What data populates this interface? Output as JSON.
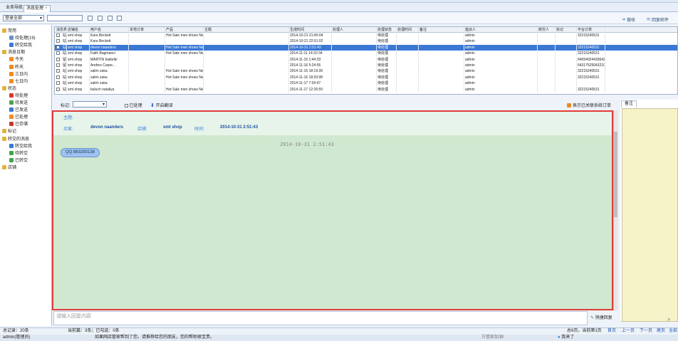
{
  "tabs": {
    "nav": "业务导航",
    "current": "消息处理"
  },
  "toolbar": {
    "account_select": "登录全部",
    "search_value": "",
    "right_buttons": [
      "搜收",
      "回复邮件"
    ]
  },
  "sidebar": {
    "items": [
      {
        "label": "常用",
        "level": 0,
        "icon": "folder-icon"
      },
      {
        "label": "待处理(19)",
        "level": 1,
        "icon": "hand-icon"
      },
      {
        "label": "转交给我",
        "level": 1,
        "icon": "forward-icon"
      },
      {
        "label": "消息日期",
        "level": 0,
        "icon": "folder-icon"
      },
      {
        "label": "今天",
        "level": 1,
        "icon": "calendar-icon"
      },
      {
        "label": "昨天",
        "level": 1,
        "icon": "calendar-icon"
      },
      {
        "label": "三日内",
        "level": 1,
        "icon": "calendar-icon"
      },
      {
        "label": "七日内",
        "level": 1,
        "icon": "calendar-icon"
      },
      {
        "label": "状态",
        "level": 0,
        "icon": "folder-icon"
      },
      {
        "label": "待处理",
        "level": 1,
        "icon": "red-dot-icon"
      },
      {
        "label": "待发送",
        "level": 1,
        "icon": "check-icon"
      },
      {
        "label": "已发送",
        "level": 1,
        "icon": "arrow-icon"
      },
      {
        "label": "已处理",
        "level": 1,
        "icon": "orange-icon"
      },
      {
        "label": "已存储",
        "level": 1,
        "icon": "store-icon"
      },
      {
        "label": "标记",
        "level": 0,
        "icon": "folder-icon"
      },
      {
        "label": "转交的消息",
        "level": 0,
        "icon": "folder-icon"
      },
      {
        "label": "转交给我",
        "level": 1,
        "icon": "forward-icon"
      },
      {
        "label": "待转交",
        "level": 1,
        "icon": "star-icon"
      },
      {
        "label": "已转交",
        "level": 1,
        "icon": "star-icon"
      },
      {
        "label": "店铺",
        "level": 0,
        "icon": "folder-icon"
      }
    ]
  },
  "grid": {
    "columns": [
      "消息类型",
      "店铺名",
      "用户名",
      "本地订单",
      "产品",
      "主题",
      "生成时间",
      "处理人",
      "处理状态",
      "处理时间",
      "备注",
      "指派人",
      "转交人",
      "标记",
      "平台订单"
    ],
    "rows": [
      [
        "站内信",
        "smt shop",
        "Kara Beckett",
        "",
        "Hot Sale men shoes New Style 2014 S...",
        "",
        "2014-10-21 21:45:04",
        "",
        "待处理",
        "",
        "",
        "admin",
        "",
        "",
        "32215240531"
      ],
      [
        "站内信",
        "smt shop",
        "Kara Beckett",
        "",
        "",
        "",
        "2014-10-21 22:01:02",
        "",
        "待处理",
        "",
        "",
        "admin",
        "",
        "",
        ""
      ],
      [
        "站内信",
        "smt shop",
        "devon naanders",
        "",
        "Hot Sale men shoes New Style 2014 S...",
        "",
        "2014-10-31 2:51:43",
        "",
        "待处理",
        "",
        "",
        "admin",
        "",
        "",
        "32215240531"
      ],
      [
        "站内信",
        "smt shop",
        "Fatih Bagmanci",
        "",
        "Hot Sale men shoes New Style 2014 S...",
        "",
        "2014-11-11 14:32:34",
        "",
        "待处理",
        "",
        "",
        "admin",
        "",
        "",
        "32215240531"
      ],
      [
        "留言",
        "smt shop",
        "MARTIN Isabelle",
        "",
        "",
        "",
        "2014-11-15 1:44:33",
        "",
        "待处理",
        "",
        "",
        "admin",
        "",
        "",
        "64054024418642"
      ],
      [
        "留言",
        "smt shop",
        "Andres Carpe...",
        "",
        "",
        "",
        "2014-11-16 5:24:55",
        "",
        "待处理",
        "",
        "",
        "admin",
        "",
        "",
        "64317525043210"
      ],
      [
        "站内信",
        "smt shop",
        "salim zaka",
        "",
        "Hot Sale men shoes New Style 2014 S...",
        "",
        "2014-11-16 18:19:39",
        "",
        "待处理",
        "",
        "",
        "admin",
        "",
        "",
        "32215240531"
      ],
      [
        "站内信",
        "smt shop",
        "salim zaka",
        "",
        "Hot Sale men shoes New Style 2014 S...",
        "",
        "2014-11-16 18:20:08",
        "",
        "待处理",
        "",
        "",
        "admin",
        "",
        "",
        "32215240531"
      ],
      [
        "站内信",
        "smt shop",
        "salim zaka",
        "",
        "",
        "",
        "2014-11-17 7:03:47",
        "",
        "待处理",
        "",
        "",
        "admin",
        "",
        "",
        ""
      ],
      [
        "站内信",
        "smt shop",
        "baluch nataliya",
        "",
        "Hot Sale men shoes New Style 2014 S...",
        "",
        "2014-11-17 12:26:59",
        "",
        "待处理",
        "",
        "",
        "admin",
        "",
        "",
        "32215240531"
      ]
    ],
    "selected_index": 2
  },
  "filter": {
    "mark_label": "标记:",
    "mark_value": "",
    "processed_label": "已处理",
    "translate_label": "开启翻译",
    "show_orders_label": "表示已关联系统订单",
    "notes_tab": "备注"
  },
  "message": {
    "subject_label": "主题:",
    "subject_value": "",
    "buyer_label": "买家:",
    "buyer_value": "devon naanders",
    "shop_label": "店铺:",
    "shop_value": "smt shop",
    "time_label": "时间:",
    "time_value": "2014-10-31 2:51:43",
    "timestamp": "2014-10-31 2:51:43",
    "bubble_text": "QQ:983283138"
  },
  "reply": {
    "placeholder": "请输入回复内容",
    "quick_reply": "快捷回复"
  },
  "status": {
    "total": "总记录：20条",
    "current_page": "当前篇：3条；已勾选：0条",
    "page_info": "总6页，当前第1页",
    "pager": [
      "首页",
      "上一页",
      "下一页",
      "尾页",
      "全部"
    ],
    "user": "admin(管理员)",
    "tip": "如果网店管家帮到了您，请推荐给您的朋友，您的帮助很宝贵。",
    "join_qq": "方管家加油!",
    "status_text": "我来了"
  },
  "colors": {
    "accent": "#3a78d4",
    "panel_border": "#e23b3b",
    "panel_bg": "#cfe8cf",
    "notes_bg": "#f7f3c8"
  }
}
